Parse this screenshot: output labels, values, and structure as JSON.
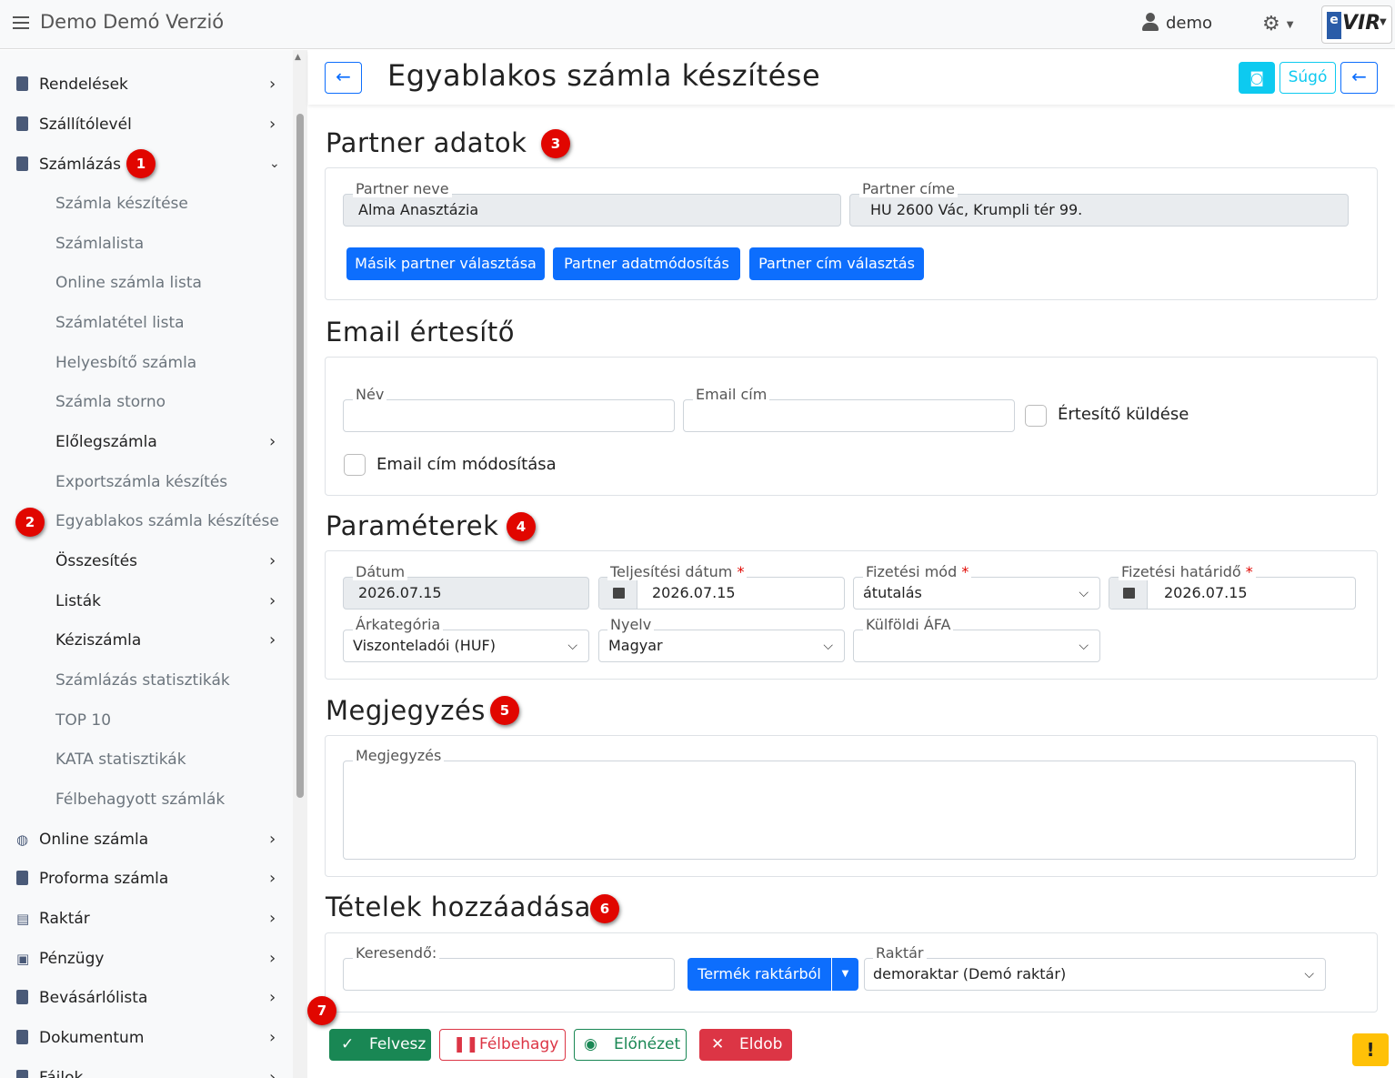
{
  "app": {
    "title": "Demo Demó Verzió",
    "user": "demo",
    "logo": "VIR",
    "logo_e": "e"
  },
  "sidebar": {
    "items": [
      {
        "label": "Rendelések"
      },
      {
        "label": "Szállítólevél"
      },
      {
        "label": "Számlázás"
      },
      {
        "label": "Online számla"
      },
      {
        "label": "Proforma számla"
      },
      {
        "label": "Raktár"
      },
      {
        "label": "Pénzügy"
      },
      {
        "label": "Bevásárlólista"
      },
      {
        "label": "Dokumentum"
      },
      {
        "label": "Fájlok"
      }
    ],
    "subitems": [
      {
        "label": "Számla készítése"
      },
      {
        "label": "Számlalista"
      },
      {
        "label": "Online számla lista"
      },
      {
        "label": "Számlatétel lista"
      },
      {
        "label": "Helyesbítő számla"
      },
      {
        "label": "Számla storno"
      },
      {
        "label": "Előlegszámla"
      },
      {
        "label": "Exportszámla készítés"
      },
      {
        "label": "Egyablakos számla készítése"
      },
      {
        "label": "Összesítés"
      },
      {
        "label": "Listák"
      },
      {
        "label": "Kéziszámla"
      },
      {
        "label": "Számlázás statisztikák"
      },
      {
        "label": "TOP 10"
      },
      {
        "label": "KATA statisztikák"
      },
      {
        "label": "Félbehagyott számlák"
      }
    ]
  },
  "badges": [
    "1",
    "2",
    "3",
    "4",
    "5",
    "6",
    "7"
  ],
  "page": {
    "title": "Egyablakos számla készítése",
    "help_label": "Súgó"
  },
  "partner": {
    "title": "Partner adatok",
    "name_label": "Partner neve",
    "name_value": "Alma Anasztázia",
    "address_label": "Partner címe",
    "address_value": "HU 2600 Vác, Krumpli tér 99.",
    "btn_other": "Másik partner választása",
    "btn_modify": "Partner adatmódosítás",
    "btn_address": "Partner cím választás"
  },
  "email": {
    "title": "Email értesítő",
    "name_label": "Név",
    "name_value": "",
    "email_label": "Email cím",
    "email_value": "",
    "send_label": "Értesítő küldése",
    "modify_label": "Email cím módosítása"
  },
  "params": {
    "title": "Paraméterek",
    "date_label": "Dátum",
    "date_value": "2026.07.15",
    "perf_label": "Teljesítési dátum",
    "perf_value": "2026.07.15",
    "pay_label": "Fizetési mód",
    "pay_value": "átutalás",
    "due_label": "Fizetési határidő",
    "due_value": "2026.07.15",
    "price_label": "Árkategória",
    "price_value": "Viszonteladói (HUF)",
    "lang_label": "Nyelv",
    "lang_value": "Magyar",
    "vat_label": "Külföldi ÁFA",
    "vat_value": "",
    "required_mark": "*"
  },
  "note": {
    "title": "Megjegyzés",
    "label": "Megjegyzés",
    "value": ""
  },
  "items": {
    "title": "Tételek hozzáadása",
    "search_label": "Keresendő:",
    "search_value": "",
    "product_btn": "Termék raktárból",
    "warehouse_label": "Raktár",
    "warehouse_value": "demoraktar (Demó raktár)"
  },
  "footer": {
    "add": "Felvesz",
    "pause": "Félbehagy",
    "preview": "Előnézet",
    "discard": "Eldob",
    "warning": "!"
  }
}
